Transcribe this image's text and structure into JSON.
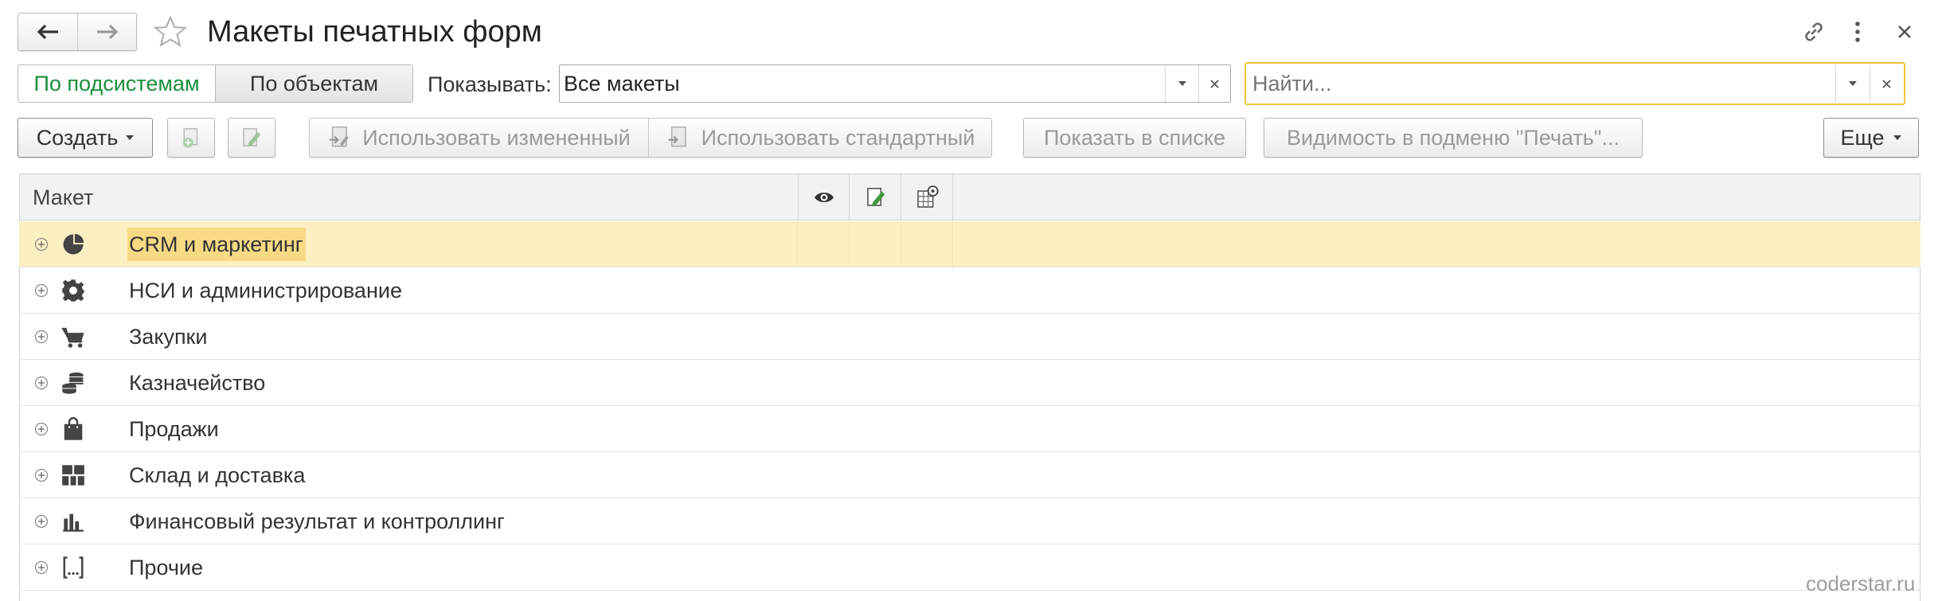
{
  "window": {
    "title": "Макеты печатных форм"
  },
  "view_switch": {
    "by_subsystems": "По подсистемам",
    "by_objects": "По объектам"
  },
  "filter": {
    "show_label": "Показывать:",
    "show_value": "Все макеты"
  },
  "search": {
    "placeholder": "Найти..."
  },
  "toolbar": {
    "create": "Создать",
    "use_modified": "Использовать измененный",
    "use_standard": "Использовать стандартный",
    "show_in_list": "Показать в списке",
    "visibility": "Видимость в подменю \"Печать\"...",
    "more": "Еще"
  },
  "table": {
    "column_header": "Макет",
    "rows": [
      {
        "label": "CRM и маркетинг",
        "icon": "pie-chart-icon",
        "selected": true
      },
      {
        "label": "НСИ и администрирование",
        "icon": "gear-icon"
      },
      {
        "label": "Закупки",
        "icon": "shopping-cart-icon"
      },
      {
        "label": "Казначейство",
        "icon": "coins-icon"
      },
      {
        "label": "Продажи",
        "icon": "shopping-bag-icon"
      },
      {
        "label": "Склад и доставка",
        "icon": "warehouse-grid-icon"
      },
      {
        "label": "Финансовый результат и контроллинг",
        "icon": "bar-chart-icon"
      },
      {
        "label": "Прочие",
        "icon": "brackets-icon"
      }
    ]
  },
  "watermark": "coderstar.ru",
  "colors": {
    "accent_green": "#1a8f3b",
    "selection_row": "#fcefc2",
    "selection_cell": "#f8da85",
    "search_border": "#f2c53d"
  }
}
